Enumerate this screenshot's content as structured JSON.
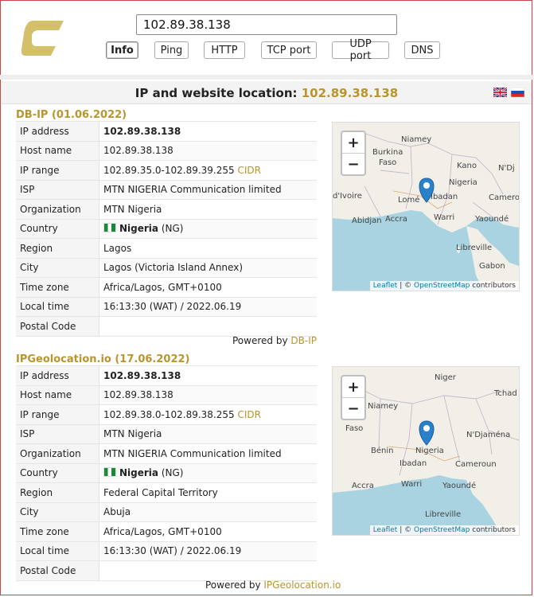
{
  "search": {
    "value": "102.89.38.138"
  },
  "nav": [
    "Info",
    "Ping",
    "HTTP",
    "TCP port",
    "UDP port",
    "DNS"
  ],
  "header": {
    "title_prefix": "IP and website location:",
    "title_ip": "102.89.38.138"
  },
  "sections": [
    {
      "title": "DB-IP (01.06.2022)",
      "rows": [
        {
          "key": "IP address",
          "value": "102.89.38.138"
        },
        {
          "key": "Host name",
          "value": "102.89.38.138"
        },
        {
          "key": "IP range",
          "value": "102.89.35.0-102.89.39.255",
          "extra": "CIDR"
        },
        {
          "key": "ISP",
          "value": "MTN NIGERIA Communication limited"
        },
        {
          "key": "Organization",
          "value": "MTN Nigeria"
        },
        {
          "key": "Country",
          "value": "Nigeria",
          "extra": "(NG)"
        },
        {
          "key": "Region",
          "value": "Lagos"
        },
        {
          "key": "City",
          "value": "Lagos (Victoria Island Annex)"
        },
        {
          "key": "Time zone",
          "value": "Africa/Lagos, GMT+0100"
        },
        {
          "key": "Local time",
          "value": "16:13:30 (WAT) / 2022.06.19"
        },
        {
          "key": "Postal Code",
          "value": ""
        }
      ],
      "powered_prefix": "Powered by",
      "powered_link": "DB-IP",
      "map": {
        "labels": [
          "Niamey",
          "Burkina",
          "Faso",
          "Kano",
          "N'Dj",
          "Nigeria",
          "d'Ivoire",
          "Lomé",
          "Ibadan",
          "Camero",
          "Abidjan",
          "Accra",
          "Warri",
          "Yaoundé",
          "Libreville",
          "Gabon"
        ]
      }
    },
    {
      "title": "IPGeolocation.io (17.06.2022)",
      "rows": [
        {
          "key": "IP address",
          "value": "102.89.38.138"
        },
        {
          "key": "Host name",
          "value": "102.89.38.138"
        },
        {
          "key": "IP range",
          "value": "102.89.38.0-102.89.38.255",
          "extra": "CIDR"
        },
        {
          "key": "ISP",
          "value": "MTN Nigeria"
        },
        {
          "key": "Organization",
          "value": "MTN NIGERIA Communication limited"
        },
        {
          "key": "Country",
          "value": "Nigeria",
          "extra": "(NG)"
        },
        {
          "key": "Region",
          "value": "Federal Capital Territory"
        },
        {
          "key": "City",
          "value": "Abuja"
        },
        {
          "key": "Time zone",
          "value": "Africa/Lagos, GMT+0100"
        },
        {
          "key": "Local time",
          "value": "16:13:30 (WAT) / 2022.06.19"
        },
        {
          "key": "Postal Code",
          "value": ""
        }
      ],
      "powered_prefix": "Powered by",
      "powered_link": "IPGeolocation.io",
      "map": {
        "labels": [
          "Niger",
          "Tchad",
          "Niamey",
          "Faso",
          "Nigeria",
          "N'Djaména",
          "Bénin",
          "Ibadan",
          "Cameroun",
          "Accra",
          "Warri",
          "Yaoundé",
          "Libreville"
        ]
      }
    }
  ],
  "map_common": {
    "zoom_in": "+",
    "zoom_out": "−",
    "attr_leaflet": "Leaflet",
    "attr_sep": "| ©",
    "attr_osm": "OpenStreetMap",
    "attr_tail": "contributors"
  },
  "colors": {
    "accent": "#b8952e",
    "map_water": "#a9d3e0",
    "map_land": "#f2efe9",
    "marker": "#2a81cb"
  }
}
